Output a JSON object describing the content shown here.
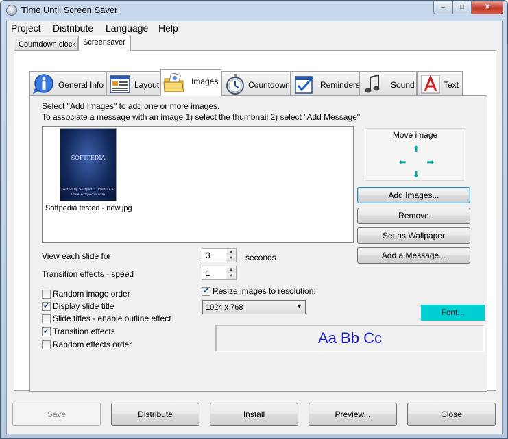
{
  "window": {
    "title": "Time Until Screen Saver",
    "controls": {
      "minimize": "–",
      "maximize": "□",
      "close": "✕"
    }
  },
  "menu": [
    "Project",
    "Distribute",
    "Language",
    "Help"
  ],
  "outer_tabs": [
    {
      "label": "Countdown clock"
    },
    {
      "label": "Screensaver",
      "active": true
    }
  ],
  "inner_tabs": [
    {
      "label": "General Info",
      "icon": "info-icon"
    },
    {
      "label": "Layout",
      "icon": "layout-icon"
    },
    {
      "label": "Images",
      "icon": "images-folder-icon",
      "active": true
    },
    {
      "label": "Countdown",
      "icon": "stopwatch-icon"
    },
    {
      "label": "Reminders",
      "icon": "checklist-icon"
    },
    {
      "label": "Sound",
      "icon": "music-note-icon"
    },
    {
      "label": "Text",
      "icon": "text-icon"
    }
  ],
  "images": {
    "instruction_1": "Select \"Add Images\" to add one or more images.",
    "instruction_2": "To associate a message with an image 1) select the thumbnail 2) select \"Add Message\"",
    "thumbnail": {
      "caption": "Softpedia tested - new.jpg",
      "image_text_top": "SOFTPEDIA",
      "image_text_bottom": "Tested by Softpedia. Visit us at www.softpedia.com"
    },
    "move_image_label": "Move image",
    "arrows": {
      "up": "⬆",
      "left": "⬅",
      "right": "➡",
      "down": "⬇"
    },
    "buttons": {
      "add_images": "Add Images...",
      "remove": "Remove",
      "set_wallpaper": "Set as Wallpaper",
      "add_message": "Add a Message..."
    },
    "view_each_slide": {
      "label": "View each slide for",
      "value": "3",
      "unit": "seconds"
    },
    "transition_speed": {
      "label": "Transition effects - speed",
      "value": "1"
    },
    "options": [
      {
        "label": "Random image order",
        "checked": false
      },
      {
        "label": "Display slide title",
        "checked": true
      },
      {
        "label": "Slide titles - enable outline effect",
        "checked": false
      },
      {
        "label": "Transition effects",
        "checked": true
      },
      {
        "label": "Random effects order",
        "checked": false
      }
    ],
    "resize": {
      "label": "Resize images to resolution:",
      "checked": true,
      "resolution": "1024 x 768"
    },
    "font_button": "Font...",
    "font_preview": "Aa Bb Cc"
  },
  "bottom_buttons": {
    "save": "Save",
    "distribute": "Distribute",
    "install": "Install",
    "preview": "Preview...",
    "close": "Close"
  },
  "colors": {
    "font_button_bg": "#00cfd4",
    "preview_text": "#2020c8",
    "arrow": "#0aa5a5"
  }
}
